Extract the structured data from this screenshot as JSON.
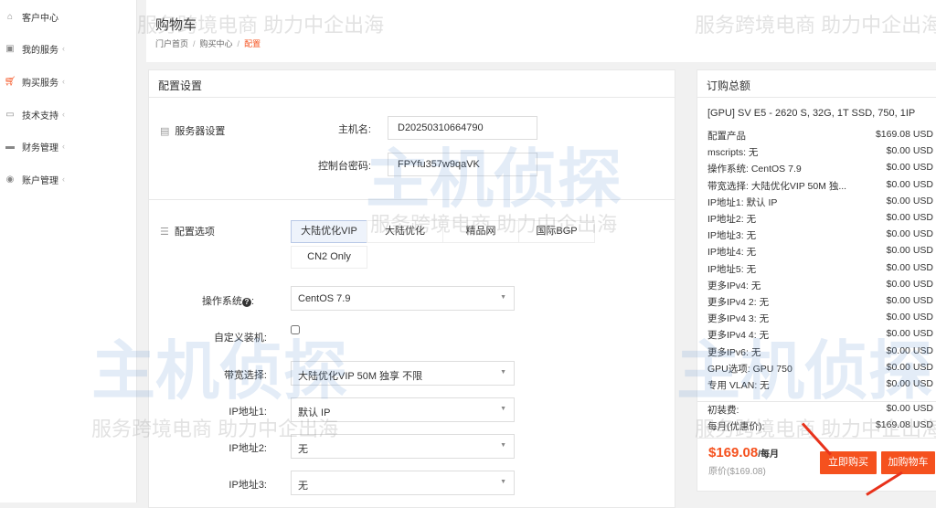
{
  "sidebar": {
    "items": [
      {
        "label": "客户中心",
        "icon": "home-icon"
      },
      {
        "label": "我的服务",
        "icon": "box-icon"
      },
      {
        "label": "购买服务",
        "icon": "cart-icon"
      },
      {
        "label": "技术支持",
        "icon": "monitor-icon"
      },
      {
        "label": "财务管理",
        "icon": "wallet-icon"
      },
      {
        "label": "账户管理",
        "icon": "user-icon"
      }
    ]
  },
  "header": {
    "title": "购物车",
    "breadcrumb": [
      "门户首页",
      "购买中心",
      "配置"
    ]
  },
  "config": {
    "title": "配置设置",
    "server_section": "服务器设置",
    "hostname_label": "主机名:",
    "hostname_value": "D20250310664790",
    "password_label": "控制台密码:",
    "password_value": "FPYfu357w9qaVK",
    "options_section": "配置选项",
    "line_options": [
      "大陆优化VIP",
      "大陆优化",
      "精品网",
      "国际BGP",
      "CN2 Only"
    ],
    "selected_line": "大陆优化VIP",
    "os_label": "操作系统",
    "os_value": "CentOS 7.9",
    "custom_label": "自定义装机:",
    "custom_checked": false,
    "bandwidth_label": "带宽选择:",
    "bandwidth_value": "大陆优化VIP 50M 独享 不限",
    "ip1_label": "IP地址1:",
    "ip1_value": "默认 IP",
    "ip2_label": "IP地址2:",
    "ip2_value": "无",
    "ip3_label": "IP地址3:",
    "ip3_value": "无"
  },
  "order": {
    "title": "订购总额",
    "product": "[GPU] SV E5 - 2620 S, 32G, 1T SSD, 750, 1IP",
    "lines": [
      {
        "name": "配置产品",
        "price": "$169.08 USD"
      },
      {
        "name": "mscripts: 无",
        "price": "$0.00 USD"
      },
      {
        "name": "操作系统: CentOS 7.9",
        "price": "$0.00 USD"
      },
      {
        "name": "带宽选择: 大陆优化VIP 50M 独...",
        "price": "$0.00 USD"
      },
      {
        "name": "IP地址1: 默认 IP",
        "price": "$0.00 USD"
      },
      {
        "name": "IP地址2: 无",
        "price": "$0.00 USD"
      },
      {
        "name": "IP地址3: 无",
        "price": "$0.00 USD"
      },
      {
        "name": "IP地址4: 无",
        "price": "$0.00 USD"
      },
      {
        "name": "IP地址5: 无",
        "price": "$0.00 USD"
      },
      {
        "name": "更多IPv4: 无",
        "price": "$0.00 USD"
      },
      {
        "name": "更多IPv4 2: 无",
        "price": "$0.00 USD"
      },
      {
        "name": "更多IPv4 3: 无",
        "price": "$0.00 USD"
      },
      {
        "name": "更多IPv4 4: 无",
        "price": "$0.00 USD"
      },
      {
        "name": "更多IPv6: 无",
        "price": "$0.00 USD"
      },
      {
        "name": "GPU选项: GPU 750",
        "price": "$0.00 USD"
      },
      {
        "name": "专用 VLAN: 无",
        "price": "$0.00 USD"
      }
    ],
    "setup_label": "初装费:",
    "setup_price": "$0.00 USD",
    "monthly_label": "每月(优惠价):",
    "monthly_price": "$169.08 USD",
    "total": "$169.08",
    "total_unit": "/每月",
    "original": "原价($169.08)",
    "buy_now": "立即购买",
    "add_cart": "加购物车"
  },
  "colors": {
    "accent": "#f5511e"
  },
  "watermark": {
    "slogan": "服务跨境电商 助力中企出海",
    "logo": "主机侦探"
  }
}
